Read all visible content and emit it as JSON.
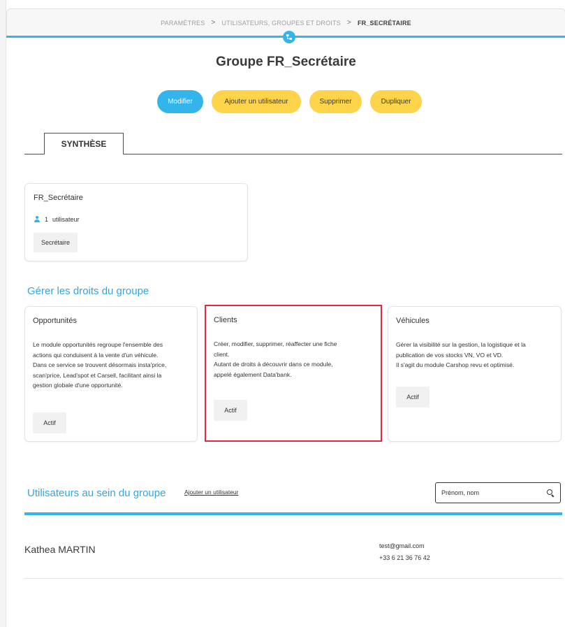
{
  "breadcrumb": {
    "items": [
      "PARAMÈTRES",
      "UTILISATEURS, GROUPES ET DROITS"
    ],
    "separator": ">",
    "current": "FR_SECRÉTAIRE"
  },
  "page": {
    "title": "Groupe FR_Secrétaire"
  },
  "actions": {
    "modify": "Modifier",
    "add_user": "Ajouter un utilisateur",
    "delete": "Supprimer",
    "duplicate": "Dupliquer"
  },
  "tabs": [
    {
      "label": "SYNTHÈSE",
      "active": true
    }
  ],
  "summary": {
    "group_name": "FR_Secrétaire",
    "user_count": "1",
    "user_label": "utilisateur",
    "tag": "Secrétaire"
  },
  "rights": {
    "section_title": "Gérer les droits du groupe",
    "cards": [
      {
        "title": "Opportunités",
        "lines": [
          "Le module opportunités regroupe l'ensemble des",
          "actions qui conduisent à la vente d'un véhicule.",
          "Dans ce service se trouvent désormais insta'price,",
          "scan'price, Lead'spot et Carsell, facilitant ainsi la",
          "gestion globale d'une opportunité."
        ],
        "status": "Actif"
      },
      {
        "title": "Clients",
        "lines": [
          "Créer, modifier, supprimer, réaffecter une fiche",
          "client.",
          "Autant de droits à découvrir dans ce module,",
          "appelé également Data'bank."
        ],
        "status": "Actif"
      },
      {
        "title": "Véhicules",
        "lines": [
          "Gérer la visibilité sur la gestion, la logistique et la",
          "publication de vos stocks VN, VO et VD.",
          "Il s'agit du module Carshop revu et optimisé."
        ],
        "status": "Actif"
      }
    ]
  },
  "users_section": {
    "title": "Utilisateurs au sein du groupe",
    "add_link": "Ajouter un utilisateur",
    "search_placeholder": "Prénom, nom",
    "users": [
      {
        "name": "Kathea MARTIN",
        "email": "test@gmail.com",
        "phone": "+33 6 21 36 76 42"
      }
    ]
  },
  "colors": {
    "accent_blue": "#33b5ec",
    "accent_yellow": "#fdd44a",
    "highlight_red": "#e5283a"
  }
}
